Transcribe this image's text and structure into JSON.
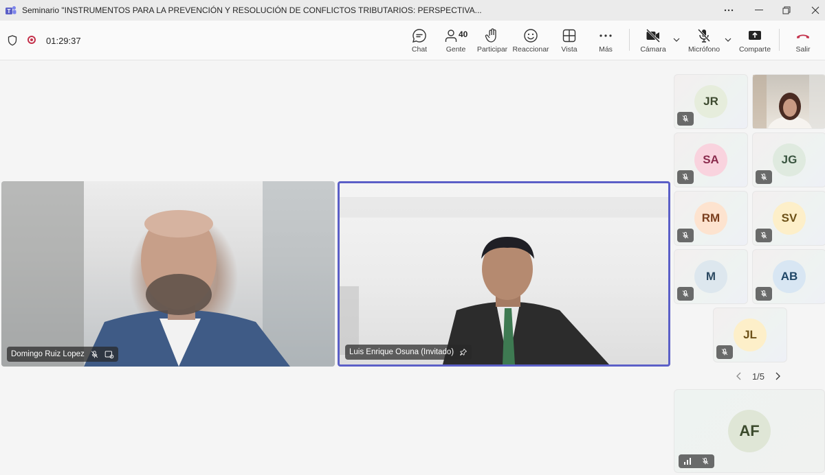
{
  "window": {
    "title": "Seminario \"INSTRUMENTOS PARA LA PREVENCIÓN Y RESOLUCIÓN DE CONFLICTOS TRIBUTARIOS: PERSPECTIVA..."
  },
  "toolbar": {
    "timer": "01:29:37",
    "chat_label": "Chat",
    "people_label": "Gente",
    "people_count": "40",
    "raise_label": "Participar",
    "react_label": "Reaccionar",
    "view_label": "Vista",
    "more_label": "Más",
    "camera_label": "Cámara",
    "mic_label": "Micrófono",
    "share_label": "Comparte",
    "leave_label": "Salir"
  },
  "stage": {
    "participants": [
      {
        "name": "Domingo Ruiz Lopez"
      },
      {
        "name": "Luis Enrique Osuna (Invitado)"
      }
    ]
  },
  "gallery": {
    "tiles": [
      {
        "initials": "JR",
        "color": "#e6eddc",
        "text_color": "#3d4a2f"
      },
      {
        "initials": "SA",
        "color": "#f9d3de",
        "text_color": "#8a2b4d"
      },
      {
        "initials": "JG",
        "color": "#dfeadf",
        "text_color": "#3a5540"
      },
      {
        "initials": "RM",
        "color": "#fde3cf",
        "text_color": "#7a3e1d"
      },
      {
        "initials": "SV",
        "color": "#fdefc9",
        "text_color": "#6d5118"
      },
      {
        "initials": "M",
        "color": "#dde7ee",
        "text_color": "#2c4a62"
      },
      {
        "initials": "AB",
        "color": "#d8e6f3",
        "text_color": "#1f4667"
      },
      {
        "initials": "JL",
        "color": "#fdefc9",
        "text_color": "#6d5118"
      }
    ],
    "pager": "1/5",
    "self_initials": "AF",
    "self_color": "#dfe6d6",
    "self_text_color": "#3b4a2c"
  },
  "colors": {
    "accent": "#5b5fc7",
    "record": "#c4314b",
    "leave": "#c4314b"
  }
}
